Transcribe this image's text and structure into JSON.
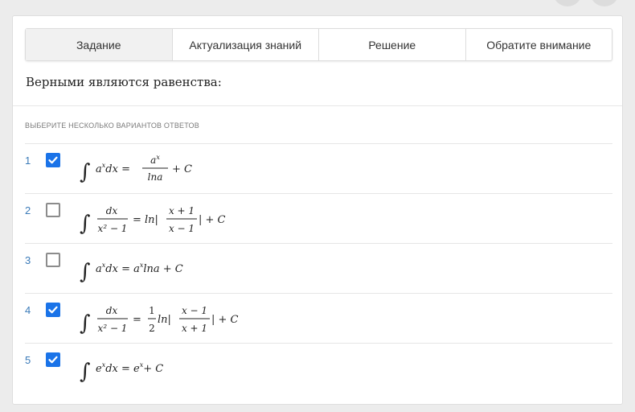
{
  "tabs": [
    {
      "label": "Задание",
      "active": true
    },
    {
      "label": "Актуализация знаний",
      "active": false
    },
    {
      "label": "Решение",
      "active": false
    },
    {
      "label": "Обратите внимание",
      "active": false
    }
  ],
  "question": "Верными являются равенства:",
  "instruction": "ВЫБЕРИТЕ НЕСКОЛЬКО ВАРИАНТОВ ОТВЕТОВ",
  "options": [
    {
      "number": "1",
      "checked": true,
      "formula": {
        "numerator": "a^x",
        "rhs_tail": "+ C",
        "lhs": "a^x dx =",
        "denominator": "lna"
      }
    },
    {
      "number": "2",
      "checked": false,
      "formula": {
        "lhs_num": "dx",
        "lhs_den": "x² − 1",
        "eq": "= ln|",
        "frac_num": "x + 1",
        "frac_den": "x − 1",
        "tail": "| + C"
      }
    },
    {
      "number": "3",
      "checked": false,
      "formula": {
        "text": "a^x dx = a^x lna + C"
      }
    },
    {
      "number": "4",
      "checked": true,
      "formula": {
        "lhs_num": "dx",
        "lhs_den": "x² − 1",
        "eq": "=",
        "coef_num": "1",
        "coef_den": "2",
        "ln": "ln|",
        "frac_num": "x − 1",
        "frac_den": "x + 1",
        "tail": "| + C"
      }
    },
    {
      "number": "5",
      "checked": true,
      "formula": {
        "text": "e^x dx = e^x + C"
      }
    }
  ],
  "colors": {
    "accent": "#1a73e8",
    "number": "#3a7ab8"
  }
}
